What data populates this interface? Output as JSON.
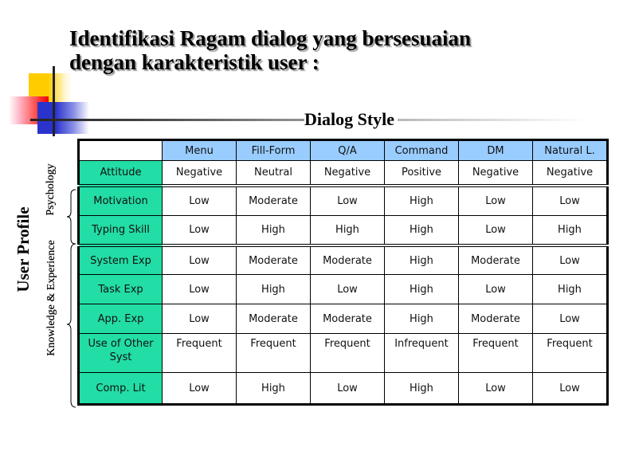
{
  "title": {
    "line1": "Identifikasi Ragam dialog yang bersesuaian",
    "line2": "dengan karakteristik user :"
  },
  "subtitle": "Dialog Style",
  "side_labels": {
    "user_profile": "User Profile",
    "psychology": "Psychology",
    "knowledge_experience": "Knowledge & Experience"
  },
  "colors": {
    "header_bg": "#99ccff",
    "rowhead_bg": "#22dda6",
    "deco_yellow": "#ffcc00",
    "deco_red": "#ee0000",
    "deco_blue": "#2a33cc"
  },
  "table": {
    "corner": "",
    "columns": [
      "Menu",
      "Fill-Form",
      "Q/A",
      "Command",
      "DM",
      "Natural L."
    ],
    "rows": [
      {
        "label": "Attitude",
        "group": "Psychology",
        "values": [
          "Negative",
          "Neutral",
          "Negative",
          "Positive",
          "Negative",
          "Negative"
        ]
      },
      {
        "label": "Motivation",
        "group": "Psychology",
        "values": [
          "Low",
          "Moderate",
          "Low",
          "High",
          "Low",
          "Low"
        ]
      },
      {
        "label": "Typing Skill",
        "group": "Psychology",
        "values": [
          "Low",
          "High",
          "High",
          "High",
          "Low",
          "High"
        ]
      },
      {
        "label": "System Exp",
        "group": "Knowledge & Experience",
        "values": [
          "Low",
          "Moderate",
          "Moderate",
          "High",
          "Moderate",
          "Low"
        ]
      },
      {
        "label": "Task Exp",
        "group": "Knowledge & Experience",
        "values": [
          "Low",
          "High",
          "Low",
          "High",
          "Low",
          "High"
        ]
      },
      {
        "label": "App. Exp",
        "group": "Knowledge & Experience",
        "values": [
          "Low",
          "Moderate",
          "Moderate",
          "High",
          "Moderate",
          "Low"
        ]
      },
      {
        "label": "Use of Other Syst",
        "group": "Knowledge & Experience",
        "values": [
          "Frequent",
          "Frequent",
          "Frequent",
          "Infrequent",
          "Frequent",
          "Frequent"
        ]
      },
      {
        "label": "Comp. Lit",
        "group": "Knowledge & Experience",
        "values": [
          "Low",
          "High",
          "Low",
          "High",
          "Low",
          "Low"
        ]
      }
    ]
  }
}
